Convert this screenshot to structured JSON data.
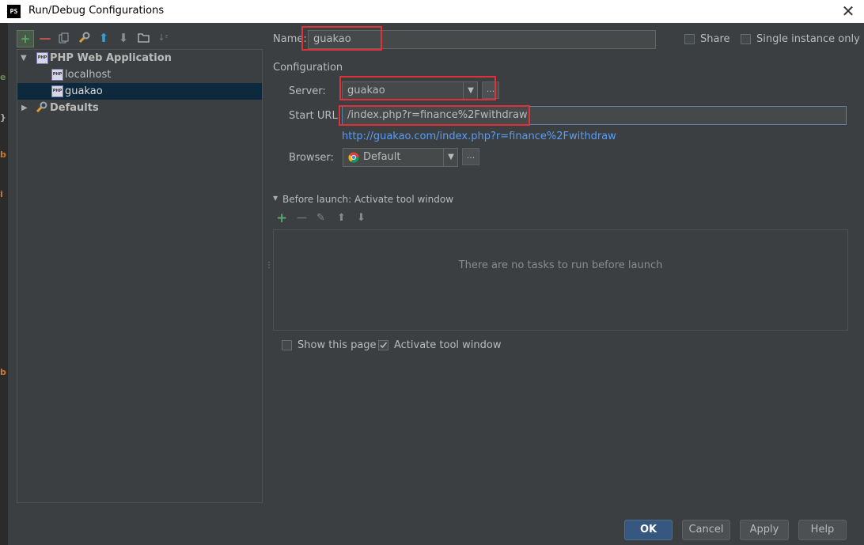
{
  "window": {
    "title": "Run/Debug Configurations",
    "app_icon": "PS",
    "close_label": "✕"
  },
  "toolbar": {
    "items": [
      {
        "name": "add-icon",
        "glyph": "+"
      },
      {
        "name": "remove-icon",
        "glyph": "—"
      },
      {
        "name": "copy-icon",
        "glyph": "⧉"
      },
      {
        "name": "wrench-icon",
        "glyph": "🔧"
      },
      {
        "name": "move-up-icon",
        "glyph": "⬆"
      },
      {
        "name": "move-down-icon",
        "glyph": "⬇"
      },
      {
        "name": "folder-icon",
        "glyph": "▬"
      },
      {
        "name": "sort-icon",
        "glyph": "↓Z"
      }
    ]
  },
  "tree": {
    "root_label": "PHP Web Application",
    "children": [
      "localhost",
      "guakao"
    ],
    "defaults_label": "Defaults",
    "selected": "guakao"
  },
  "form": {
    "name_label": "Name:",
    "name_value": "guakao",
    "share_label": "Share",
    "single_instance_label": "Single instance only",
    "configuration_label": "Configuration",
    "server_label": "Server:",
    "server_value": "guakao",
    "server_more": "...",
    "start_url_label": "Start URL:",
    "start_url_value": "/index.php?r=finance%2Fwithdraw",
    "full_url": "http://guakao.com/index.php?r=finance%2Fwithdraw",
    "browser_label": "Browser:",
    "browser_value": "Default",
    "browser_more": "..."
  },
  "before_launch": {
    "header": "Before launch: Activate tool window",
    "empty_text": "There are no tasks to run before launch",
    "show_page_label": "Show this page",
    "activate_label": "Activate tool window",
    "show_page_checked": false,
    "activate_checked": true
  },
  "buttons": {
    "ok": "OK",
    "cancel": "Cancel",
    "apply": "Apply",
    "help": "Help"
  },
  "colors": {
    "accent": "#365880",
    "highlight": "#e0303a",
    "link": "#589df6",
    "add_green": "#59a869"
  }
}
